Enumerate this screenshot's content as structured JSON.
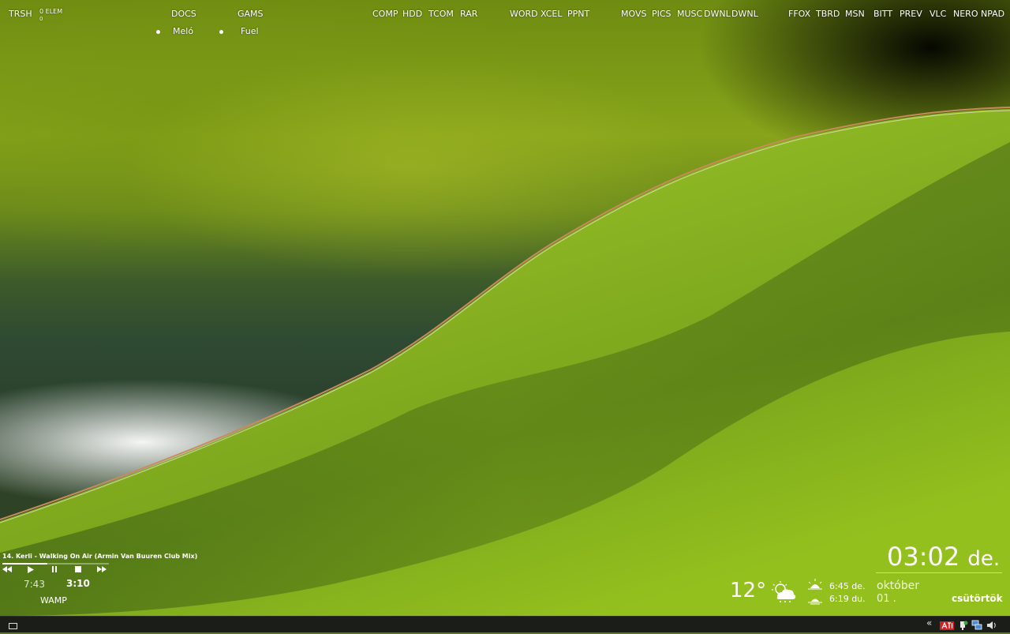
{
  "desktop_labels": {
    "trash": "TRSH",
    "trash_count": "0 ELEM",
    "trash_sub": "0",
    "docs": "DOCS",
    "docs_sub": "Meló",
    "games": "GAMS",
    "games_sub": "Fuel",
    "comp": "COMP",
    "hdd": "HDD",
    "tcom": "TCOM",
    "rar": "RAR",
    "word": "WORD",
    "xcel": "XCEL",
    "ppnt": "PPNT",
    "movs": "MOVS",
    "pics": "PICS",
    "musc": "MUSC",
    "dwnl1": "DWNL",
    "dwnl2": "DWNL",
    "ffox": "FFOX",
    "tbrd": "TBRD",
    "msn": "MSN",
    "bitt": "BITT",
    "prev": "PREV",
    "vlc": "VLC",
    "nero": "NERO",
    "npad": "NPAD"
  },
  "player": {
    "track": "14. Kerli - Walking On Air (Armin Van Buuren Club Mix)",
    "elapsed": "7:43",
    "total": "3:10",
    "launcher": "WAMP",
    "progress": 0.42,
    "controls": [
      "rewind-icon",
      "play-icon",
      "pause-icon",
      "stop-icon",
      "forward-icon"
    ]
  },
  "clock": {
    "time": "03:02",
    "ampm": "de."
  },
  "weather": {
    "temperature": "12°",
    "icon": "partly-cloudy-rain-icon",
    "sunrise": "6:45 de.",
    "sunset": "6:19 du."
  },
  "date": {
    "month": "október",
    "day": "01 .",
    "weekday": "csütörtök"
  },
  "taskbar": {
    "tray_chevron": "«",
    "tray_icons": [
      "ati-icon",
      "safely-remove-icon",
      "network-icon",
      "volume-icon"
    ]
  },
  "colors": {
    "leaf": "#8db41c",
    "taskbar": "#1b1e18",
    "ati_red": "#d21f1f"
  }
}
